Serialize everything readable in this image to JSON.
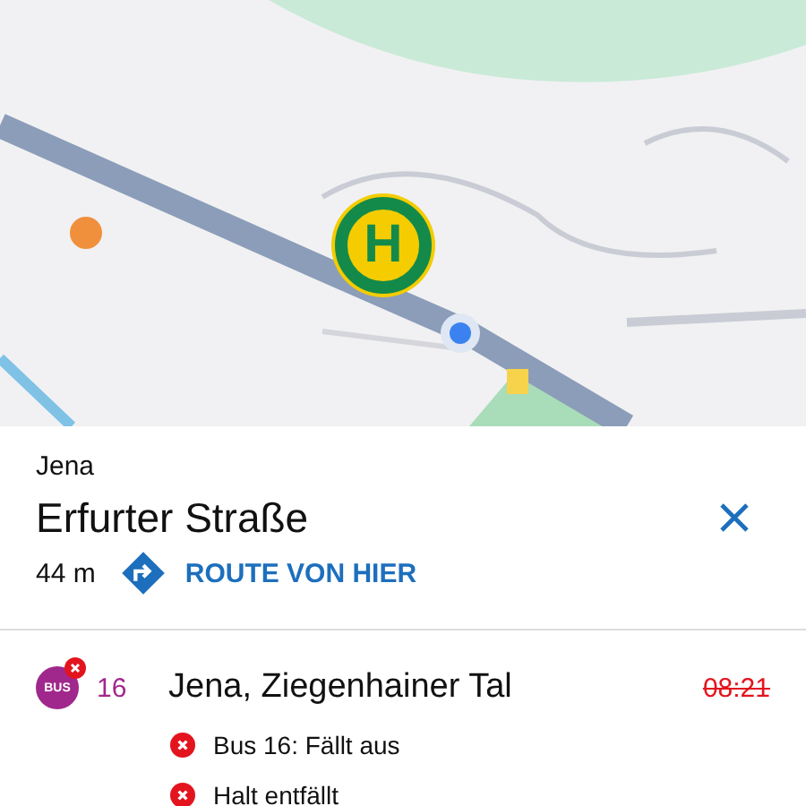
{
  "map": {
    "stop_marker": {
      "label": "H"
    }
  },
  "stop": {
    "city": "Jena",
    "name": "Erfurter Straße",
    "distance": "44 m",
    "route_link": "ROUTE VON HIER"
  },
  "departures": [
    {
      "mode": "BUS",
      "cancelled": true,
      "line": "16",
      "destination": "Jena, Ziegenhainer Tal",
      "time": "08:21",
      "notices": [
        {
          "text": "Bus 16: Fällt aus"
        },
        {
          "text": "Halt entfällt"
        }
      ]
    }
  ]
}
